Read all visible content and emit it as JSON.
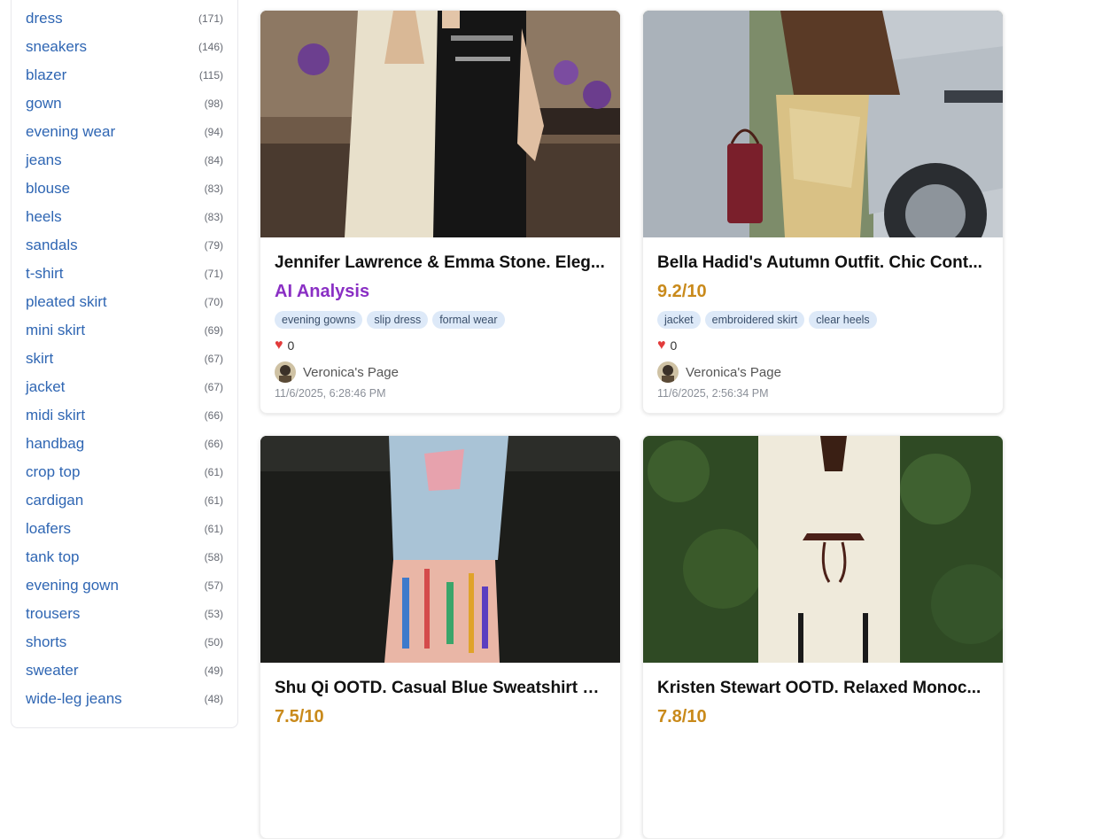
{
  "sidebar": {
    "tags": [
      {
        "name": "dress",
        "count": "(171)"
      },
      {
        "name": "sneakers",
        "count": "(146)"
      },
      {
        "name": "blazer",
        "count": "(115)"
      },
      {
        "name": "gown",
        "count": "(98)"
      },
      {
        "name": "evening wear",
        "count": "(94)"
      },
      {
        "name": "jeans",
        "count": "(84)"
      },
      {
        "name": "blouse",
        "count": "(83)"
      },
      {
        "name": "heels",
        "count": "(83)"
      },
      {
        "name": "sandals",
        "count": "(79)"
      },
      {
        "name": "t-shirt",
        "count": "(71)"
      },
      {
        "name": "pleated skirt",
        "count": "(70)"
      },
      {
        "name": "mini skirt",
        "count": "(69)"
      },
      {
        "name": "skirt",
        "count": "(67)"
      },
      {
        "name": "jacket",
        "count": "(67)"
      },
      {
        "name": "midi skirt",
        "count": "(66)"
      },
      {
        "name": "handbag",
        "count": "(66)"
      },
      {
        "name": "crop top",
        "count": "(61)"
      },
      {
        "name": "cardigan",
        "count": "(61)"
      },
      {
        "name": "loafers",
        "count": "(61)"
      },
      {
        "name": "tank top",
        "count": "(58)"
      },
      {
        "name": "evening gown",
        "count": "(57)"
      },
      {
        "name": "trousers",
        "count": "(53)"
      },
      {
        "name": "shorts",
        "count": "(50)"
      },
      {
        "name": "sweater",
        "count": "(49)"
      },
      {
        "name": "wide-leg jeans",
        "count": "(48)"
      }
    ]
  },
  "cards": [
    {
      "title": "Jennifer Lawrence & Emma Stone. Eleg...",
      "score": "AI Analysis",
      "score_color": "#8a2fc4",
      "tags": [
        "evening gowns",
        "slip dress",
        "formal wear"
      ],
      "likes": "0",
      "author": "Veronica's Page",
      "timestamp": "11/6/2025, 6:28:46 PM"
    },
    {
      "title": "Bella Hadid's Autumn Outfit. Chic Cont...",
      "score": "9.2/10",
      "score_color": "#c98a1b",
      "tags": [
        "jacket",
        "embroidered skirt",
        "clear heels"
      ],
      "likes": "0",
      "author": "Veronica's Page",
      "timestamp": "11/6/2025, 2:56:34 PM"
    },
    {
      "title": "Shu Qi OOTD. Casual Blue Sweatshirt w...",
      "score": "7.5/10",
      "score_color": "#c98a1b"
    },
    {
      "title": "Kristen Stewart OOTD. Relaxed Monoc...",
      "score": "7.8/10",
      "score_color": "#c98a1b"
    }
  ],
  "icons": {
    "heart": "heart-icon",
    "avatar": "avatar"
  }
}
